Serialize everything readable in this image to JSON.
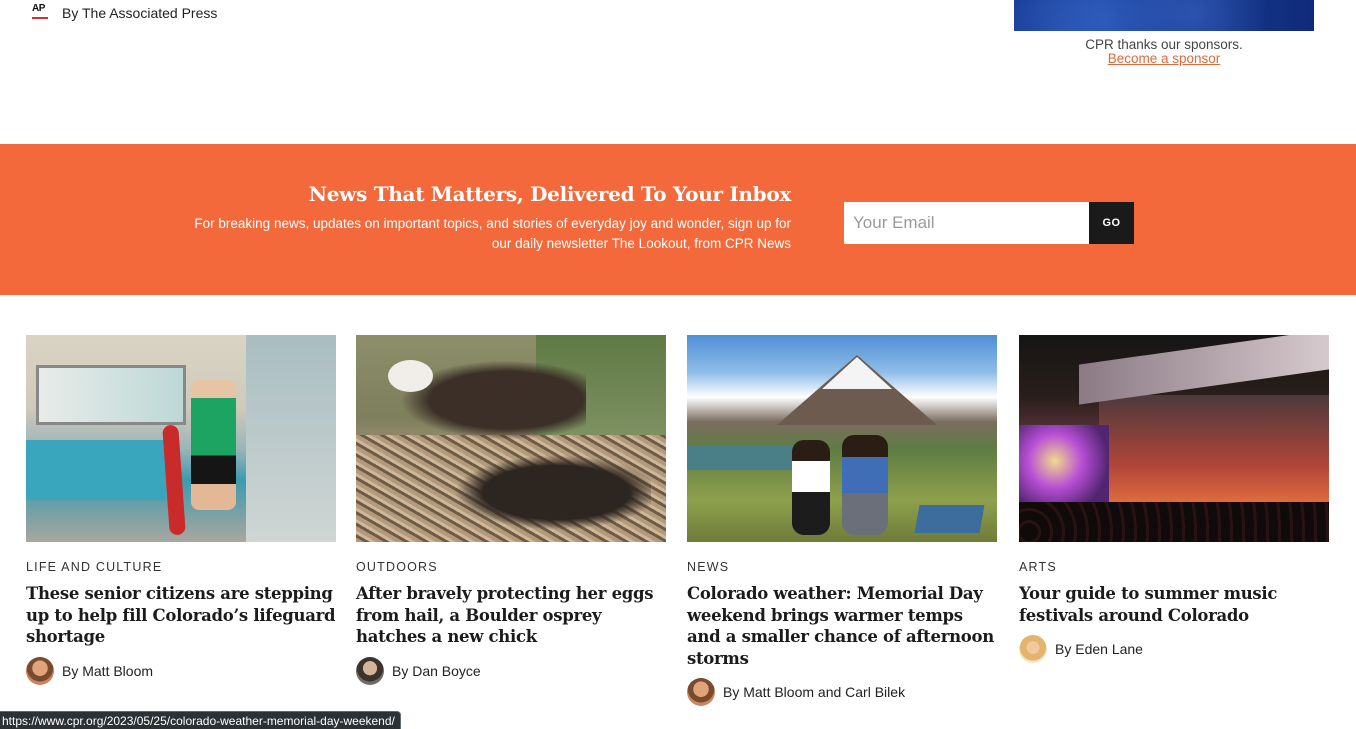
{
  "top_byline": {
    "logo_text": "AP",
    "text": "By The Associated Press"
  },
  "sponsor": {
    "thanks": "CPR thanks our sponsors.",
    "link_label": "Become a sponsor"
  },
  "newsletter": {
    "title": "News That Matters, Delivered To Your Inbox",
    "description": "For breaking news, updates on important topics, and stories of everyday joy and wonder, sign up for our daily newsletter The Lookout, from CPR News",
    "email_placeholder": "Your Email",
    "submit_label": "GO",
    "background_color": "#f4693b"
  },
  "articles": [
    {
      "category": "LIFE AND CULTURE",
      "headline": "These senior citizens are stepping up to help fill Colorado’s lifeguard shortage",
      "author": "By Matt Bloom"
    },
    {
      "category": "OUTDOORS",
      "headline": "After bravely protecting her eggs from hail, a Boulder osprey hatches a new chick",
      "author": "By Dan Boyce"
    },
    {
      "category": "NEWS",
      "headline": "Colorado weather: Memorial Day weekend brings warmer temps and a smaller chance of afternoon storms",
      "author": "By Matt Bloom and Carl Bilek"
    },
    {
      "category": "ARTS",
      "headline": "Your guide to summer music festivals around Colorado",
      "author": "By Eden Lane"
    }
  ],
  "status_bar": {
    "url": "https://www.cpr.org/2023/05/25/colorado-weather-memorial-day-weekend/"
  },
  "colors": {
    "accent": "#f4693b",
    "link": "#e2673a",
    "dark_button": "#1a1a1a"
  }
}
